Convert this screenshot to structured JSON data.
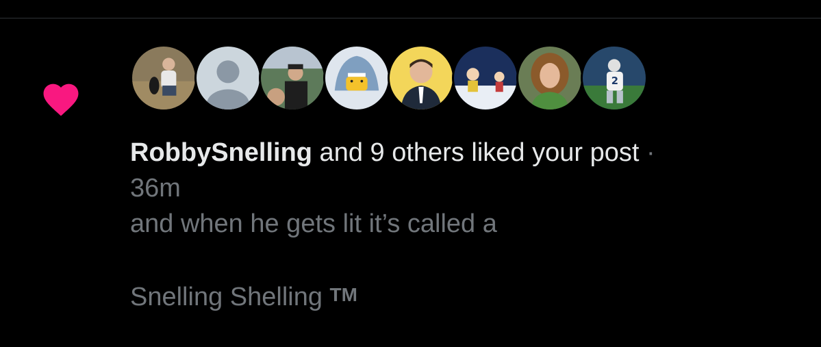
{
  "notification": {
    "type": "like",
    "heart_color": "#f91880",
    "avatars": [
      {
        "name": "avatar-1"
      },
      {
        "name": "avatar-2-default"
      },
      {
        "name": "avatar-3"
      },
      {
        "name": "avatar-4"
      },
      {
        "name": "avatar-5"
      },
      {
        "name": "avatar-6"
      },
      {
        "name": "avatar-7"
      },
      {
        "name": "avatar-8"
      }
    ],
    "username": "RobbySnelling",
    "summary_rest": " and 9 others liked your post",
    "separator": " ·",
    "timestamp": "36m",
    "post_line_1": "and when he gets lit it’s called a",
    "post_line_3": "Snelling Shelling ",
    "post_tm": "TM"
  }
}
